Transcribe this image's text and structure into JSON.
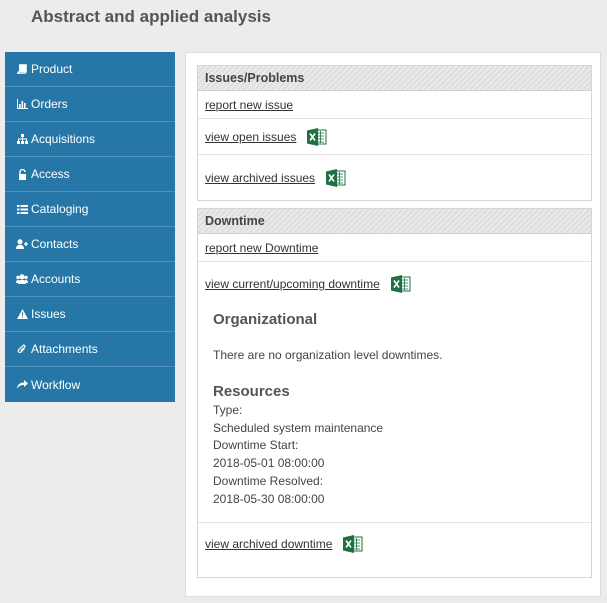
{
  "page": {
    "title": "Abstract and applied analysis"
  },
  "sidebar": {
    "items": [
      {
        "label": "Product",
        "icon": "book-icon"
      },
      {
        "label": "Orders",
        "icon": "bar-chart-icon"
      },
      {
        "label": "Acquisitions",
        "icon": "sitemap-icon"
      },
      {
        "label": "Access",
        "icon": "unlock-icon"
      },
      {
        "label": "Cataloging",
        "icon": "list-icon"
      },
      {
        "label": "Contacts",
        "icon": "user-plus-icon"
      },
      {
        "label": "Accounts",
        "icon": "users-icon"
      },
      {
        "label": "Issues",
        "icon": "warning-icon"
      },
      {
        "label": "Attachments",
        "icon": "paperclip-icon"
      },
      {
        "label": "Workflow",
        "icon": "share-icon"
      }
    ],
    "bg_color": "#2677a8"
  },
  "issues": {
    "heading": "Issues/Problems",
    "report_link": "report new issue",
    "open_link": "view open issues",
    "archived_link": "view archived issues"
  },
  "downtime": {
    "heading": "Downtime",
    "report_link": "report new Downtime",
    "current_link": "view current/upcoming downtime",
    "organizational": {
      "heading": "Organizational",
      "message": "There are no organization level downtimes."
    },
    "resources": {
      "heading": "Resources",
      "type_label": "Type:",
      "type_value": "Scheduled system maintenance",
      "start_label": "Downtime Start:",
      "start_value": "2018-05-01 08:00:00",
      "resolved_label": "Downtime Resolved:",
      "resolved_value": "2018-05-30 08:00:00"
    },
    "archived_link": "view archived downtime"
  },
  "colors": {
    "excel_green": "#1e7145"
  }
}
